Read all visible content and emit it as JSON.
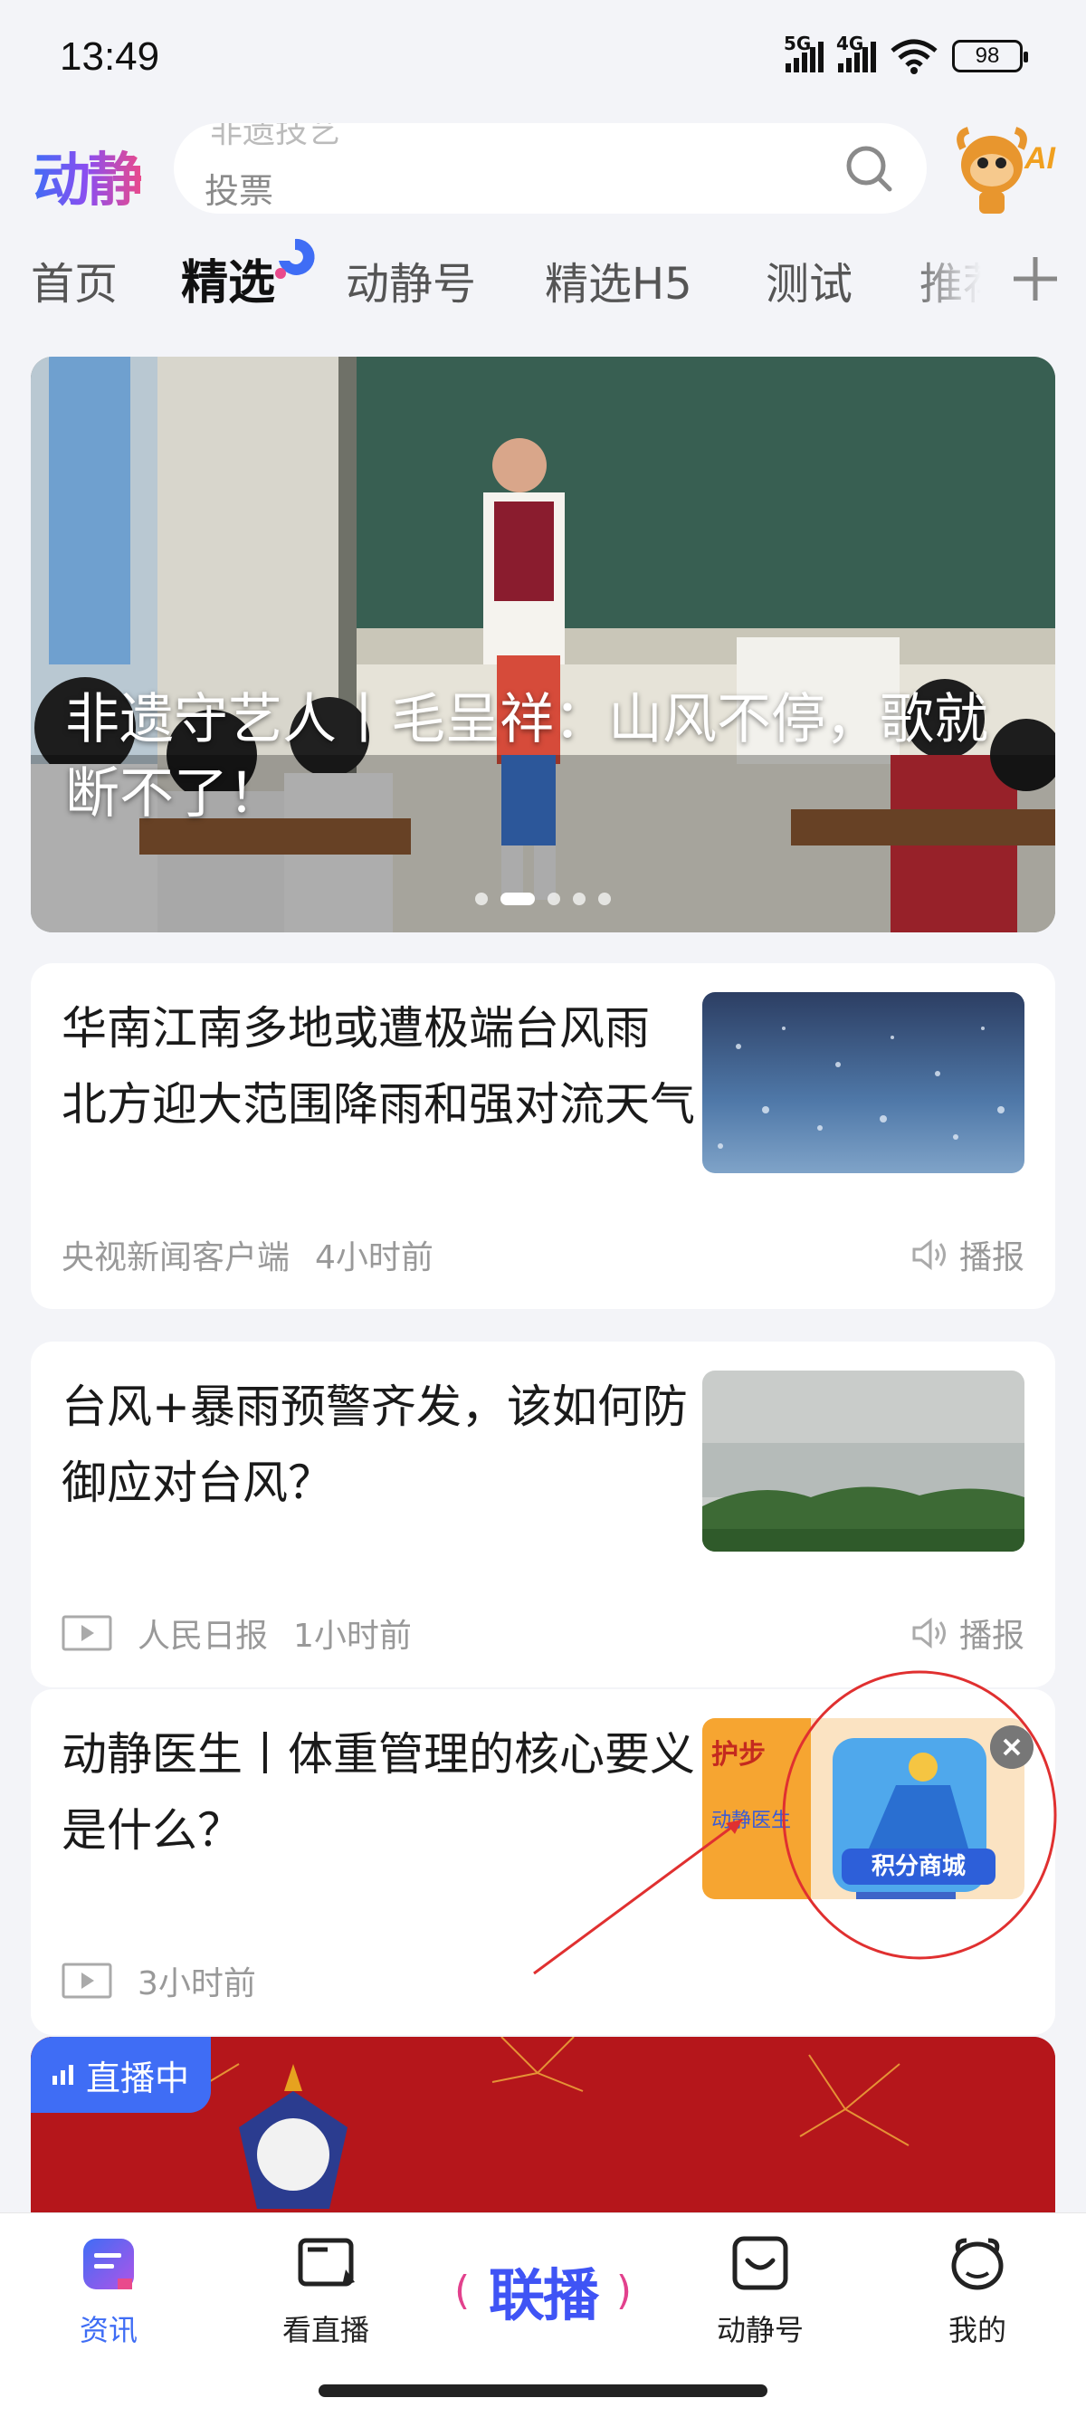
{
  "status_bar": {
    "time": "13:49",
    "net1": "5G",
    "net2": "4G",
    "battery": "98"
  },
  "header": {
    "logo": "动静",
    "search_ghost": "非遗技艺",
    "search_placeholder": "投票",
    "ai_label": "AI"
  },
  "tabs": [
    {
      "label": "首页"
    },
    {
      "label": "精选"
    },
    {
      "label": "动静号"
    },
    {
      "label": "精选H5"
    },
    {
      "label": "测试"
    },
    {
      "label": "推荐"
    }
  ],
  "banner": {
    "title": "非遗守艺人丨毛呈祥：山风不停，歌就断不了！",
    "slide_index": 2,
    "slide_count": 5
  },
  "news": [
    {
      "title": "华南江南多地或遭极端台风雨 北方迎大范围降雨和强对流天气",
      "source": "央视新闻客户端",
      "time": "4小时前",
      "speak": "播报"
    },
    {
      "title": "台风+暴雨预警齐发，该如何防御应对台风？",
      "source": "人民日报",
      "time": "1小时前",
      "speak": "播报"
    },
    {
      "title": "动静医生丨体重管理的核心要义是什么？",
      "time": "3小时前",
      "thumb_text": "动静医生"
    }
  ],
  "float_widget": {
    "label": "积分商城"
  },
  "live": {
    "badge": "直播中"
  },
  "bottom_nav": {
    "items": [
      {
        "label": "资讯"
      },
      {
        "label": "看直播"
      },
      {
        "label": "联播"
      },
      {
        "label": "动静号"
      },
      {
        "label": "我的"
      }
    ]
  },
  "colors": {
    "accent": "#3f6df5",
    "pink": "#e94a8c",
    "background": "#f3f4f8",
    "live_red": "#b5161b"
  }
}
